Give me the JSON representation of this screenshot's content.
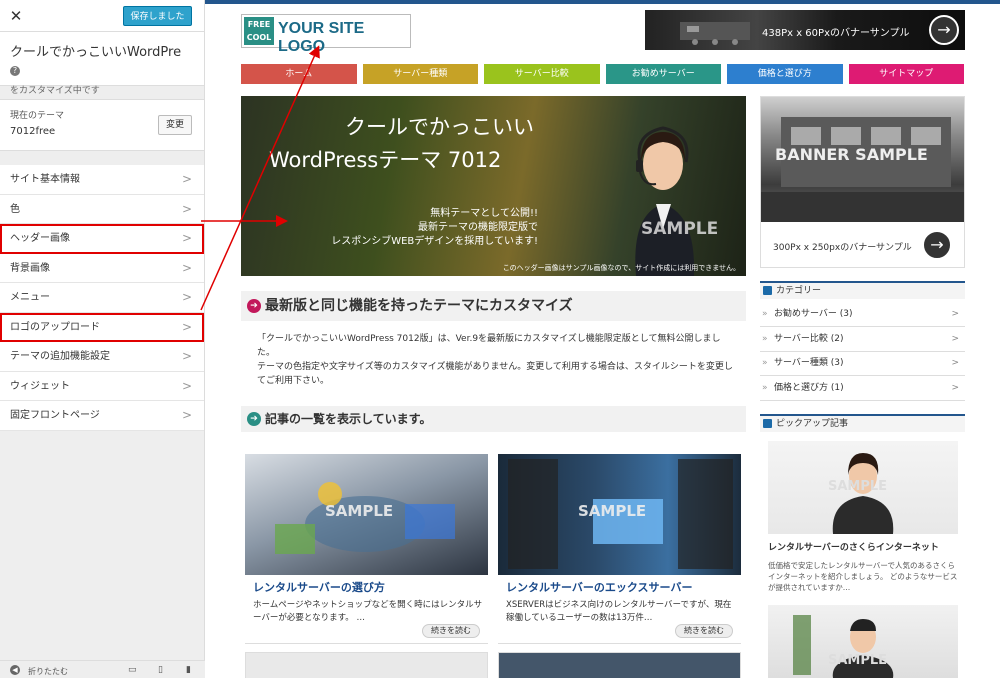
{
  "customizer": {
    "close_glyph": "✕",
    "save_label": "保存しました",
    "site_title": "クールでかっこいいWordPre...",
    "help_glyph": "?",
    "subtitle": "をカスタマイズ中です",
    "theme_label": "現在のテーマ",
    "theme_name": "7012free",
    "change_label": "変更",
    "menu": [
      {
        "label": "サイト基本情報"
      },
      {
        "label": "色"
      },
      {
        "label": "ヘッダー画像",
        "highlighted": true
      },
      {
        "label": "背景画像"
      },
      {
        "label": "メニュー"
      },
      {
        "label": "ロゴのアップロード",
        "highlighted": true
      },
      {
        "label": "テーマの追加機能設定"
      },
      {
        "label": "ウィジェット"
      },
      {
        "label": "固定フロントページ"
      }
    ],
    "arrow_glyph": ">",
    "collapse_icon": "◀",
    "collapse_label": "折りたたむ",
    "device_icons": [
      "desktop-icon",
      "tablet-icon",
      "mobile-icon"
    ]
  },
  "preview": {
    "logo": {
      "badge_line1": "FREE",
      "badge_line2": "COOL",
      "text": "YOUR SITE LOGO"
    },
    "top_banner": {
      "text": "438Px x 60Pxのバナーサンプル",
      "arrow": "→"
    },
    "nav": [
      {
        "label": "ホーム",
        "color": "#d4544a"
      },
      {
        "label": "サーバー種類",
        "color": "#c6a226"
      },
      {
        "label": "サーバー比較",
        "color": "#9ac31d"
      },
      {
        "label": "お勧めサーバー",
        "color": "#2a9688"
      },
      {
        "label": "価格と選び方",
        "color": "#2d7fcf"
      },
      {
        "label": "サイトマップ",
        "color": "#de1b73"
      }
    ],
    "hero": {
      "line1": "クールでかっこいい",
      "line2": "WordPressテーマ 7012",
      "copy1": "無料テーマとして公開!!",
      "copy2": "最新テーマの機能限定版で",
      "copy3": "レスポンシブWEBデザインを採用しています!",
      "note": "このヘッダー画像はサンプル画像なので、サイト作成には利用できません。",
      "watermark": "SAMPLE"
    },
    "side_banner": {
      "watermark": "BANNER SAMPLE",
      "text": "300Px x 250pxのバナーサンプル",
      "arrow": "→"
    },
    "section1": {
      "icon": "➔",
      "heading": "最新版と同じ機能を持ったテーマにカスタマイズ",
      "para1": "「クールでかっこいいWordPress 7012版」は、Ver.9を最新版にカスタマイズし機能限定版として無料公開しました。",
      "para2": "テーマの色指定や文字サイズ等のカスタマイズ機能がありません。変更して利用する場合は、スタイルシートを変更してご利用下さい。"
    },
    "section2": {
      "icon": "➔",
      "heading": "記事の一覧を表示しています。"
    },
    "cards": [
      {
        "title": "レンタルサーバーの選び方",
        "excerpt": "ホームページやネットショップなどを開く時にはレンタルサーバーが必要となります。 …",
        "more": "続きを読む",
        "watermark": "SAMPLE"
      },
      {
        "title": "レンタルサーバーのエックスサーバー",
        "excerpt": "XSERVERはビジネス向けのレンタルサーバーですが、現在稼働しているユーザーの数は13万件…",
        "more": "続きを読む",
        "watermark": "SAMPLE"
      }
    ],
    "categories": {
      "heading": "カテゴリー",
      "items": [
        {
          "label": "お勧めサーバー (3)"
        },
        {
          "label": "サーバー比較 (2)"
        },
        {
          "label": "サーバー種類 (3)"
        },
        {
          "label": "価格と選び方 (1)"
        }
      ],
      "bullet": "»",
      "arrow": ">"
    },
    "pickup": {
      "heading": "ピックアップ記事",
      "items": [
        {
          "title": "レンタルサーバーのさくらインターネット",
          "excerpt": "低価格で安定したレンタルサーバーで人気のあるさくらインターネットを紹介しましょう。 どのようなサービスが提供されていますか…",
          "watermark": "SAMPLE"
        },
        {
          "watermark": "SAMPLE"
        }
      ]
    },
    "accent_colors": {
      "topline": "#23568d",
      "save_button": "#2ea2cc",
      "highlight_red": "#e00000"
    }
  }
}
